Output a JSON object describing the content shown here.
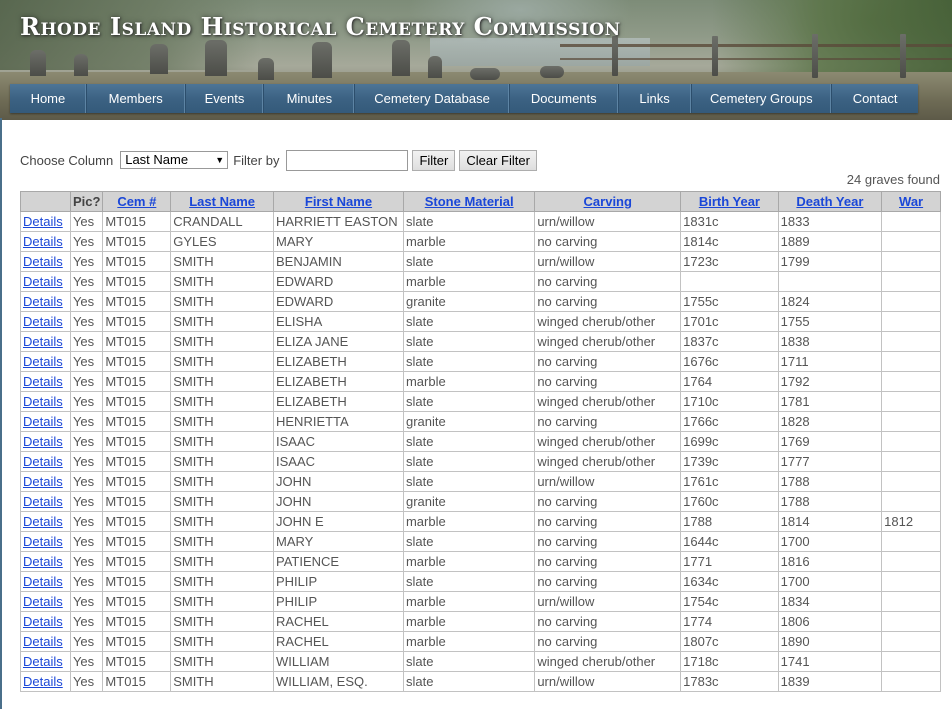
{
  "site_title": "Rhode Island Historical Cemetery Commission",
  "nav": [
    "Home",
    "Members",
    "Events",
    "Minutes",
    "Cemetery Database",
    "Documents",
    "Links",
    "Cemetery Groups",
    "Contact"
  ],
  "filter": {
    "choose_label": "Choose Column",
    "column_value": "Last Name",
    "filter_label": "Filter by",
    "filter_value": "",
    "filter_button": "Filter",
    "clear_button": "Clear Filter"
  },
  "result_count": "24 graves found",
  "table": {
    "headers": [
      "",
      "Pic?",
      "Cem #",
      "Last Name",
      "First Name",
      "Stone Material",
      "Carving",
      "Birth Year",
      "Death Year",
      "War"
    ],
    "rows": [
      [
        "Details",
        "Yes",
        "MT015",
        "CRANDALL",
        "HARRIETT EASTON",
        "slate",
        "urn/willow",
        "1831c",
        "1833",
        ""
      ],
      [
        "Details",
        "Yes",
        "MT015",
        "GYLES",
        "MARY",
        "marble",
        "no carving",
        "1814c",
        "1889",
        ""
      ],
      [
        "Details",
        "Yes",
        "MT015",
        "SMITH",
        "BENJAMIN",
        "slate",
        "urn/willow",
        "1723c",
        "1799",
        ""
      ],
      [
        "Details",
        "Yes",
        "MT015",
        "SMITH",
        "EDWARD",
        "marble",
        "no carving",
        "",
        "",
        ""
      ],
      [
        "Details",
        "Yes",
        "MT015",
        "SMITH",
        "EDWARD",
        "granite",
        "no carving",
        "1755c",
        "1824",
        ""
      ],
      [
        "Details",
        "Yes",
        "MT015",
        "SMITH",
        "ELISHA",
        "slate",
        "winged cherub/other",
        "1701c",
        "1755",
        ""
      ],
      [
        "Details",
        "Yes",
        "MT015",
        "SMITH",
        "ELIZA JANE",
        "slate",
        "winged cherub/other",
        "1837c",
        "1838",
        ""
      ],
      [
        "Details",
        "Yes",
        "MT015",
        "SMITH",
        "ELIZABETH",
        "slate",
        "no carving",
        "1676c",
        "1711",
        ""
      ],
      [
        "Details",
        "Yes",
        "MT015",
        "SMITH",
        "ELIZABETH",
        "marble",
        "no carving",
        "1764",
        "1792",
        ""
      ],
      [
        "Details",
        "Yes",
        "MT015",
        "SMITH",
        "ELIZABETH",
        "slate",
        "winged cherub/other",
        "1710c",
        "1781",
        ""
      ],
      [
        "Details",
        "Yes",
        "MT015",
        "SMITH",
        "HENRIETTA",
        "granite",
        "no carving",
        "1766c",
        "1828",
        ""
      ],
      [
        "Details",
        "Yes",
        "MT015",
        "SMITH",
        "ISAAC",
        "slate",
        "winged cherub/other",
        "1699c",
        "1769",
        ""
      ],
      [
        "Details",
        "Yes",
        "MT015",
        "SMITH",
        "ISAAC",
        "slate",
        "winged cherub/other",
        "1739c",
        "1777",
        ""
      ],
      [
        "Details",
        "Yes",
        "MT015",
        "SMITH",
        "JOHN",
        "slate",
        "urn/willow",
        "1761c",
        "1788",
        ""
      ],
      [
        "Details",
        "Yes",
        "MT015",
        "SMITH",
        "JOHN",
        "granite",
        "no carving",
        "1760c",
        "1788",
        ""
      ],
      [
        "Details",
        "Yes",
        "MT015",
        "SMITH",
        "JOHN E",
        "marble",
        "no carving",
        "1788",
        "1814",
        "1812"
      ],
      [
        "Details",
        "Yes",
        "MT015",
        "SMITH",
        "MARY",
        "slate",
        "no carving",
        "1644c",
        "1700",
        ""
      ],
      [
        "Details",
        "Yes",
        "MT015",
        "SMITH",
        "PATIENCE",
        "marble",
        "no carving",
        "1771",
        "1816",
        ""
      ],
      [
        "Details",
        "Yes",
        "MT015",
        "SMITH",
        "PHILIP",
        "slate",
        "no carving",
        "1634c",
        "1700",
        ""
      ],
      [
        "Details",
        "Yes",
        "MT015",
        "SMITH",
        "PHILIP",
        "marble",
        "urn/willow",
        "1754c",
        "1834",
        ""
      ],
      [
        "Details",
        "Yes",
        "MT015",
        "SMITH",
        "RACHEL",
        "marble",
        "no carving",
        "1774",
        "1806",
        ""
      ],
      [
        "Details",
        "Yes",
        "MT015",
        "SMITH",
        "RACHEL",
        "marble",
        "no carving",
        "1807c",
        "1890",
        ""
      ],
      [
        "Details",
        "Yes",
        "MT015",
        "SMITH",
        "WILLIAM",
        "slate",
        "winged cherub/other",
        "1718c",
        "1741",
        ""
      ],
      [
        "Details",
        "Yes",
        "MT015",
        "SMITH",
        "WILLIAM, ESQ.",
        "slate",
        "urn/willow",
        "1783c",
        "1839",
        ""
      ]
    ]
  }
}
